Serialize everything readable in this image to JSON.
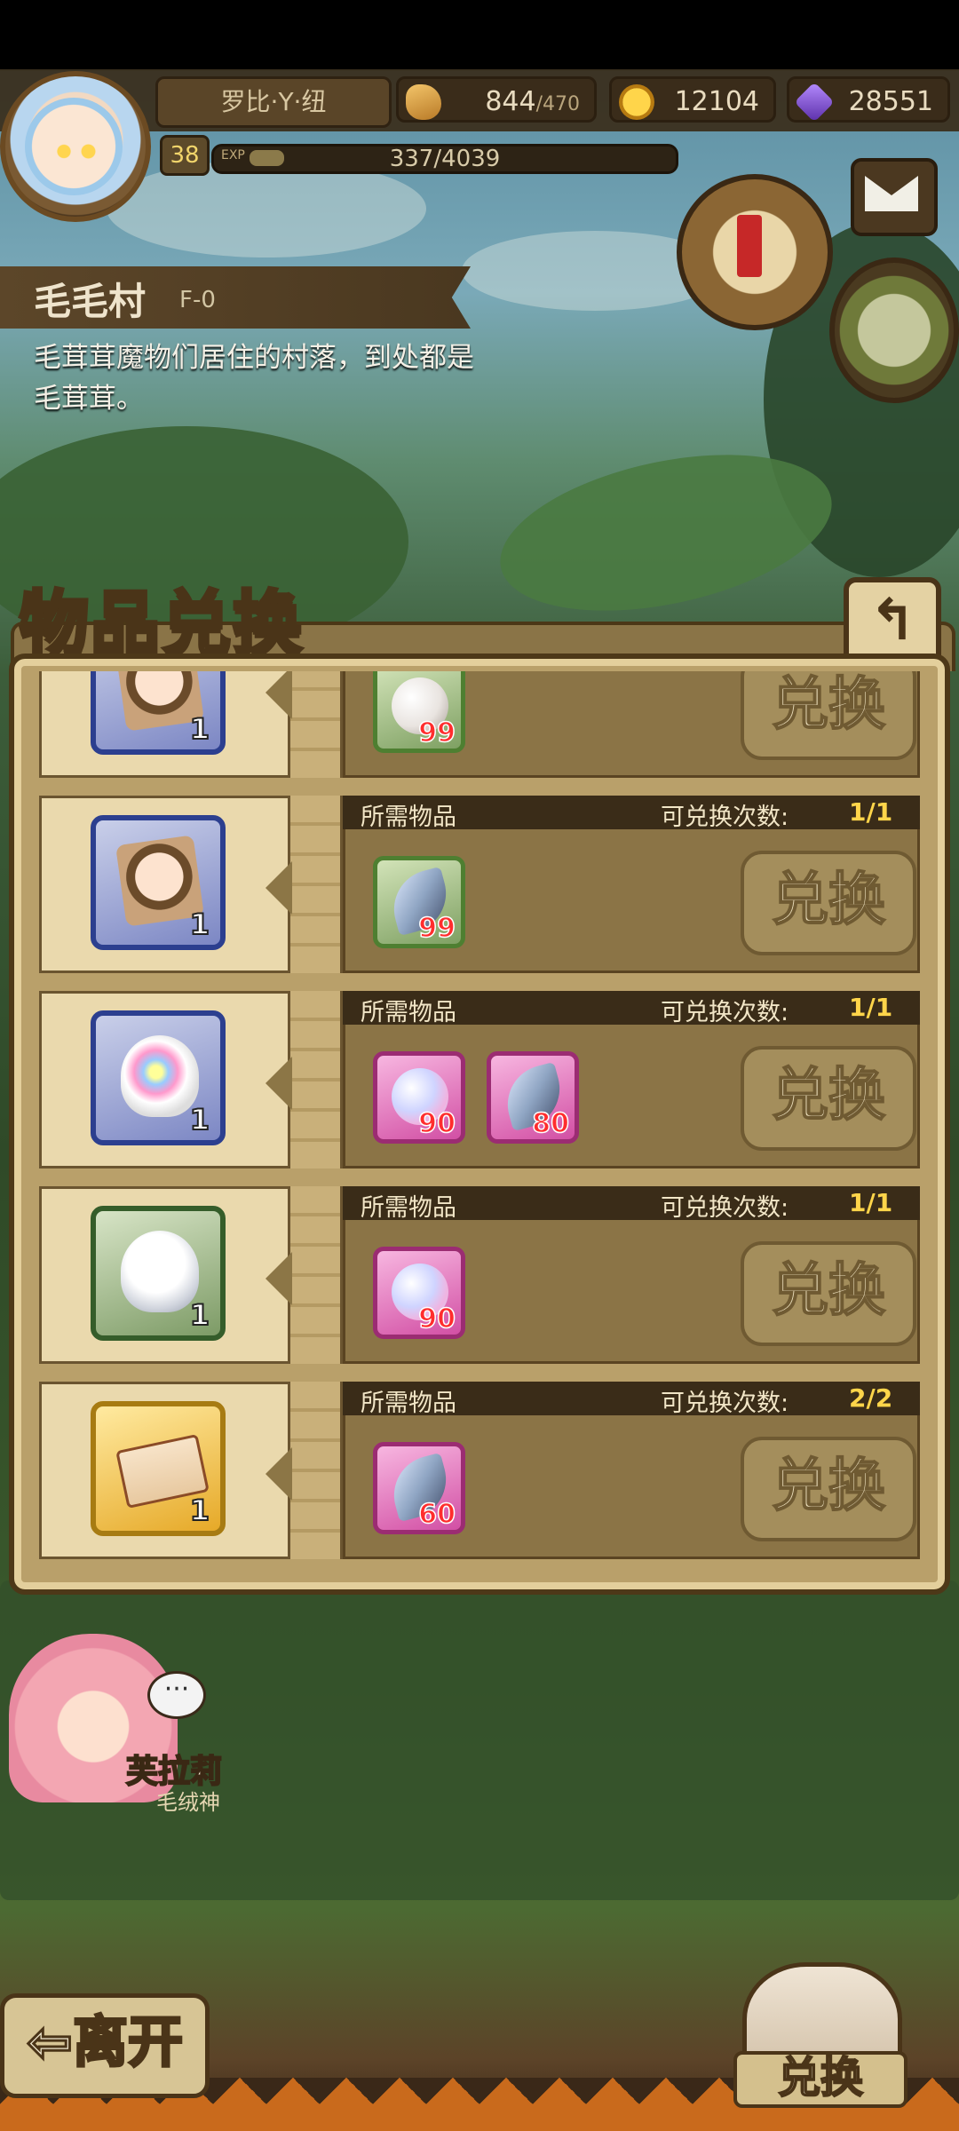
{
  "header": {
    "player_name": "罗比·Y·纽",
    "level": "38",
    "exp_label": "EXP",
    "exp_text": "337/4039",
    "exp_fraction": 0.083,
    "stamina": "844",
    "stamina_max": "/470",
    "gold": "12104",
    "gems": "28551"
  },
  "location": {
    "name": "毛毛村",
    "code": "F-0",
    "description": "毛茸茸魔物们居住的村落，到处都是毛茸茸。"
  },
  "panel": {
    "title": "物品兑换",
    "back_icon": "↰",
    "need_label": "所需物品",
    "count_label": "可兑换次数:",
    "button_label": "兑换"
  },
  "rows": [
    {
      "reward": "character-fragment",
      "reward_qty": "1",
      "frame": "blue",
      "materials": [
        {
          "icon": "white-fluff",
          "qty": "99",
          "frame": "green"
        }
      ],
      "count": "",
      "partial": true
    },
    {
      "reward": "character-fragment",
      "reward_qty": "1",
      "frame": "blue",
      "materials": [
        {
          "icon": "gray-feather",
          "qty": "99",
          "frame": "green"
        }
      ],
      "count": "1/1"
    },
    {
      "reward": "rainbow-slime-egg",
      "reward_qty": "1",
      "frame": "blue",
      "materials": [
        {
          "icon": "rainbow-fluff",
          "qty": "90",
          "frame": "pink"
        },
        {
          "icon": "blue-feather",
          "qty": "80",
          "frame": "pink"
        }
      ],
      "count": "1/1"
    },
    {
      "reward": "white-slime-egg",
      "reward_qty": "1",
      "frame": "green",
      "materials": [
        {
          "icon": "rainbow-fluff",
          "qty": "90",
          "frame": "pink"
        }
      ],
      "count": "1/1"
    },
    {
      "reward": "ticket",
      "reward_qty": "1",
      "frame": "gold",
      "materials": [
        {
          "icon": "blue-feather",
          "qty": "60",
          "frame": "pink"
        }
      ],
      "count": "2/2"
    }
  ],
  "npc": {
    "name": "芙拉莉",
    "title": "毛绒神",
    "bubble": "···"
  },
  "footer": {
    "leave_label": "离开",
    "leave_icon": "⇦",
    "swap_label": "兑换"
  }
}
